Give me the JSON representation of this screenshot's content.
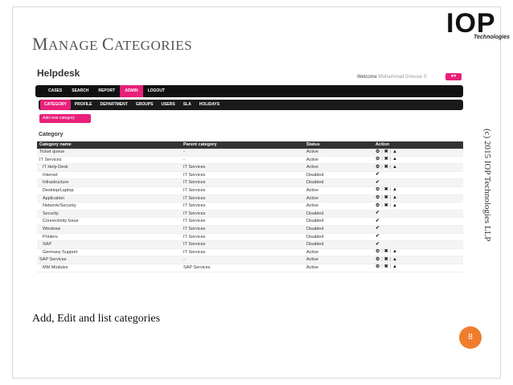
{
  "slide": {
    "title_prefix_big": "M",
    "title_rest_1": "ANAGE ",
    "title_prefix_big_2": "C",
    "title_rest_2": "ATEGORIES",
    "vertical_text": "(c) 2015 IOP Technologies LLP",
    "caption": "Add, Edit and list categories",
    "page_number": "8",
    "logo_letters": "IOP",
    "logo_sub": "Technologies"
  },
  "colors": {
    "accent": "#e8207a",
    "page_badge": "#f07d2e",
    "nav_dark": "#111111"
  },
  "app": {
    "title": "Helpdesk",
    "welcome_label": "Welcome",
    "welcome_user": "Mohammad Ghouse S",
    "user_menu_icon": "user-icon",
    "nav_main": [
      "CASES",
      "SEARCH",
      "REPORT",
      "ADMIN",
      "LOGOUT"
    ],
    "nav_main_active": "ADMIN",
    "nav_admin": [
      "CATEGORY",
      "PROFILE",
      "DEPARTMENT",
      "GROUPS",
      "USERS",
      "SLA",
      "HOLIDAYS"
    ],
    "nav_admin_active": "CATEGORY",
    "add_button": "Add new category",
    "section_title": "Category",
    "table": {
      "headers": [
        "Category name",
        "Parent category",
        "Status",
        "Action"
      ],
      "rows": [
        {
          "name": "Ticket queue",
          "parent": "-",
          "status": "Active",
          "actions": "full",
          "child": false
        },
        {
          "name": "IT Services",
          "parent": "-",
          "status": "Active",
          "actions": "full",
          "child": false
        },
        {
          "name": "IT Help Desk",
          "parent": "IT Services",
          "status": "Active",
          "actions": "full",
          "child": true
        },
        {
          "name": "Internet",
          "parent": "IT Services",
          "status": "Disabled",
          "actions": "check",
          "child": true
        },
        {
          "name": "Infrastructure",
          "parent": "IT Services",
          "status": "Disabled",
          "actions": "check",
          "child": true
        },
        {
          "name": "Desktop/Laptop",
          "parent": "IT Services",
          "status": "Active",
          "actions": "full",
          "child": true
        },
        {
          "name": "Application",
          "parent": "IT Services",
          "status": "Active",
          "actions": "full",
          "child": true
        },
        {
          "name": "Network/Security",
          "parent": "IT Services",
          "status": "Active",
          "actions": "full",
          "child": true
        },
        {
          "name": "Security",
          "parent": "IT Services",
          "status": "Disabled",
          "actions": "check",
          "child": true
        },
        {
          "name": "Connectivity Issue",
          "parent": "IT Services",
          "status": "Disabled",
          "actions": "check",
          "child": true
        },
        {
          "name": "Windows",
          "parent": "IT Services",
          "status": "Disabled",
          "actions": "check",
          "child": true
        },
        {
          "name": "Printers",
          "parent": "IT Services",
          "status": "Disabled",
          "actions": "check",
          "child": true
        },
        {
          "name": "SAP",
          "parent": "IT Services",
          "status": "Disabled",
          "actions": "check",
          "child": true
        },
        {
          "name": "Germany Support",
          "parent": "IT Services",
          "status": "Active",
          "actions": "full",
          "child": true
        },
        {
          "name": "SAP Services",
          "parent": "-",
          "status": "Active",
          "actions": "full",
          "child": false
        },
        {
          "name": "MM Modules",
          "parent": "SAP Services",
          "status": "Active",
          "actions": "full",
          "child": true
        }
      ],
      "action_icons": {
        "edit": "gear-icon",
        "delete": "close-icon",
        "assign": "user-icon",
        "enable": "check-icon"
      }
    }
  }
}
